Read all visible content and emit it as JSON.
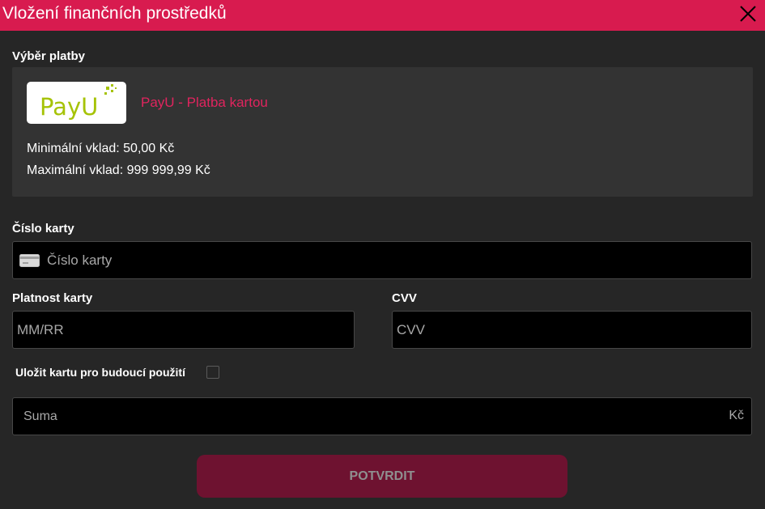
{
  "header": {
    "title": "Vložení finančních prostředků",
    "close_icon": "close-icon"
  },
  "payment_selection": {
    "label": "Výběr platby",
    "method": {
      "logo": "PayU",
      "name": "PayU - Platba kartou"
    },
    "min_deposit": "Minimální vklad: 50,00 Kč",
    "max_deposit": "Maximální vklad: 999 999,99 Kč"
  },
  "card_number": {
    "label": "Číslo karty",
    "placeholder": "Číslo karty",
    "value": "",
    "icon": "credit-card-icon"
  },
  "expiry": {
    "label": "Platnost karty",
    "placeholder": "MM/RR",
    "value": ""
  },
  "cvv": {
    "label": "CVV",
    "placeholder": "CVV",
    "value": ""
  },
  "save_card": {
    "label": "Uložit kartu pro budoucí použití",
    "checked": false
  },
  "amount": {
    "placeholder": "Suma",
    "value": "",
    "currency": "Kč"
  },
  "confirm_button": {
    "label": "POTVRDIT"
  },
  "colors": {
    "accent": "#d81b4f",
    "background": "#262626",
    "panel": "#333333",
    "button_disabled": "#6e1230",
    "payu_green": "#a6c307"
  }
}
